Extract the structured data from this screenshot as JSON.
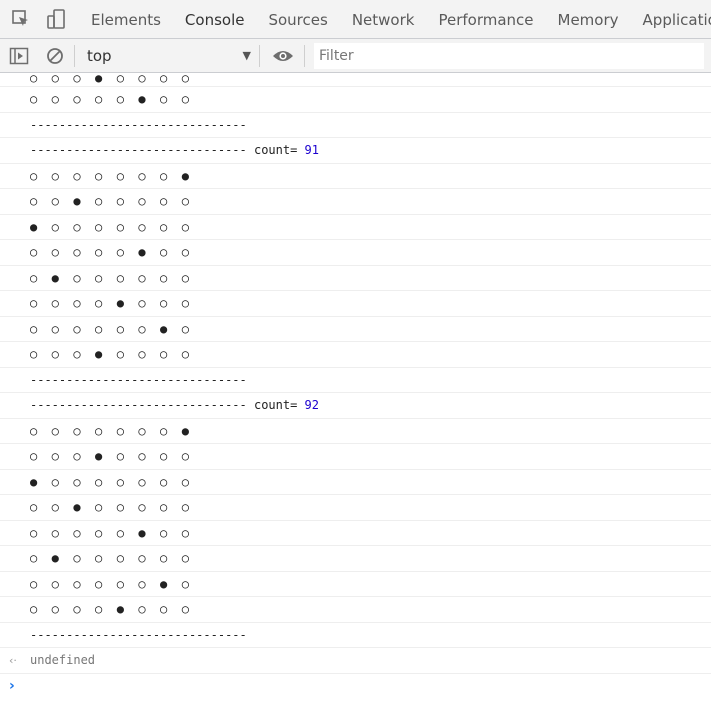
{
  "tabs": [
    "Elements",
    "Console",
    "Sources",
    "Network",
    "Performance",
    "Memory",
    "Application"
  ],
  "active_tab": "Console",
  "toolbar": {
    "context": "top",
    "filter_placeholder": "Filter"
  },
  "icons": {
    "inspect": "cursor-inspect-icon",
    "device": "device-toggle-icon",
    "sidebar": "sidebar-toggle-icon",
    "clear": "clear-console-icon",
    "eye": "eye-icon"
  },
  "colors": {
    "accent": "#1a73e8",
    "number": "#1c00cf",
    "result": "#777777"
  },
  "console": {
    "lines": [
      "○  ○  ○  ●  ○  ○  ○  ○",
      "○  ○  ○  ○  ○  ●  ○  ○",
      "------------------------------",
      "------------------------------ count= ",
      "○  ○  ○  ○  ○  ○  ○  ●",
      "○  ○  ●  ○  ○  ○  ○  ○",
      "●  ○  ○  ○  ○  ○  ○  ○",
      "○  ○  ○  ○  ○  ●  ○  ○",
      "○  ●  ○  ○  ○  ○  ○  ○",
      "○  ○  ○  ○  ●  ○  ○  ○",
      "○  ○  ○  ○  ○  ○  ●  ○",
      "○  ○  ○  ●  ○  ○  ○  ○",
      "------------------------------",
      "------------------------------ count= ",
      "○  ○  ○  ○  ○  ○  ○  ●",
      "○  ○  ○  ●  ○  ○  ○  ○",
      "●  ○  ○  ○  ○  ○  ○  ○",
      "○  ○  ●  ○  ○  ○  ○  ○",
      "○  ○  ○  ○  ○  ●  ○  ○",
      "○  ●  ○  ○  ○  ○  ○  ○",
      "○  ○  ○  ○  ○  ○  ●  ○",
      "○  ○  ○  ○  ●  ○  ○  ○",
      "------------------------------"
    ],
    "count_a": "91",
    "count_b": "92",
    "result_glyph": "‹·",
    "result": "undefined",
    "prompt_glyph": "›"
  }
}
